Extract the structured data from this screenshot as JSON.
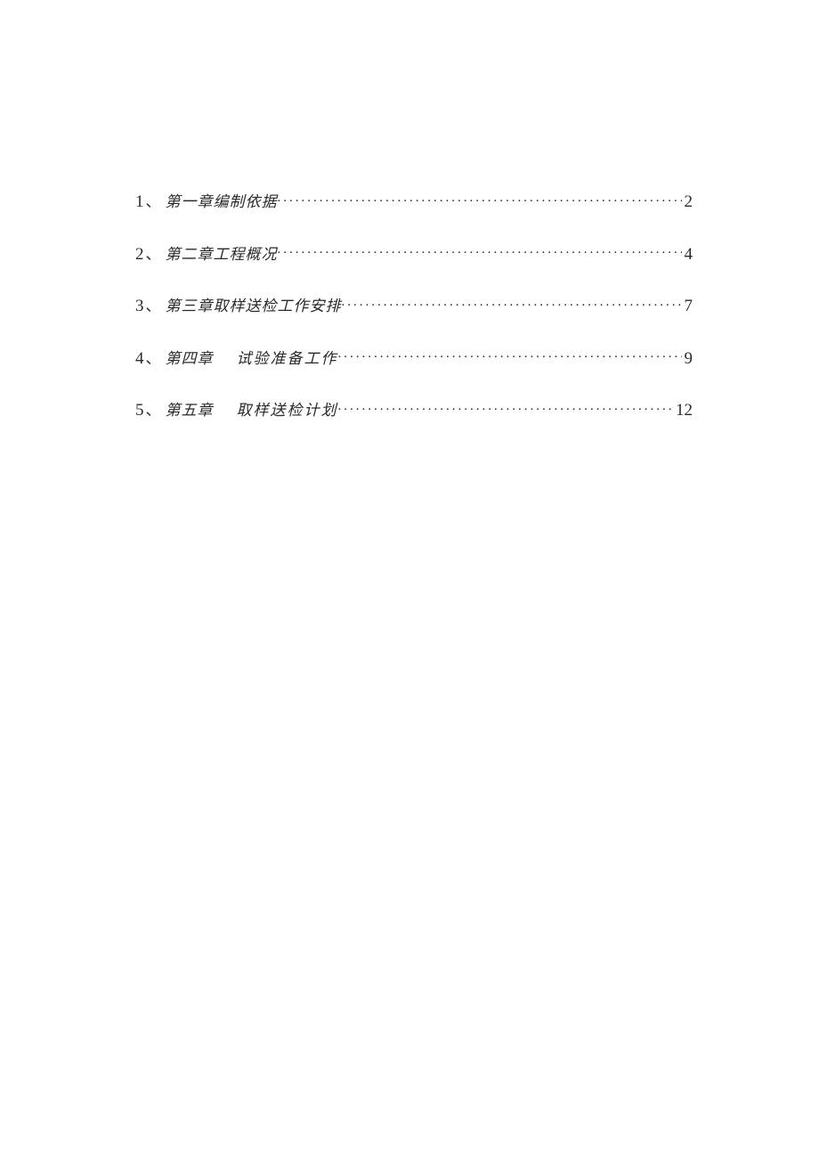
{
  "toc": {
    "entries": [
      {
        "num": "1",
        "sep": "、",
        "chapter": "第一章",
        "title": "编制依据",
        "page": "2",
        "spaced": false
      },
      {
        "num": "2",
        "sep": "、",
        "chapter": "第二章",
        "title": "工程概况",
        "page": "4",
        "spaced": false
      },
      {
        "num": "3",
        "sep": "、",
        "chapter": "第三章",
        "title": "取样送检工作安排",
        "page": "7",
        "spaced": false
      },
      {
        "num": "4",
        "sep": "、",
        "chapter": "第四章",
        "title": "试验准备工作",
        "page": "9",
        "spaced": true
      },
      {
        "num": "5",
        "sep": "、",
        "chapter": "第五章",
        "title": "取样送检计划",
        "page": "12",
        "spaced": true
      }
    ]
  }
}
